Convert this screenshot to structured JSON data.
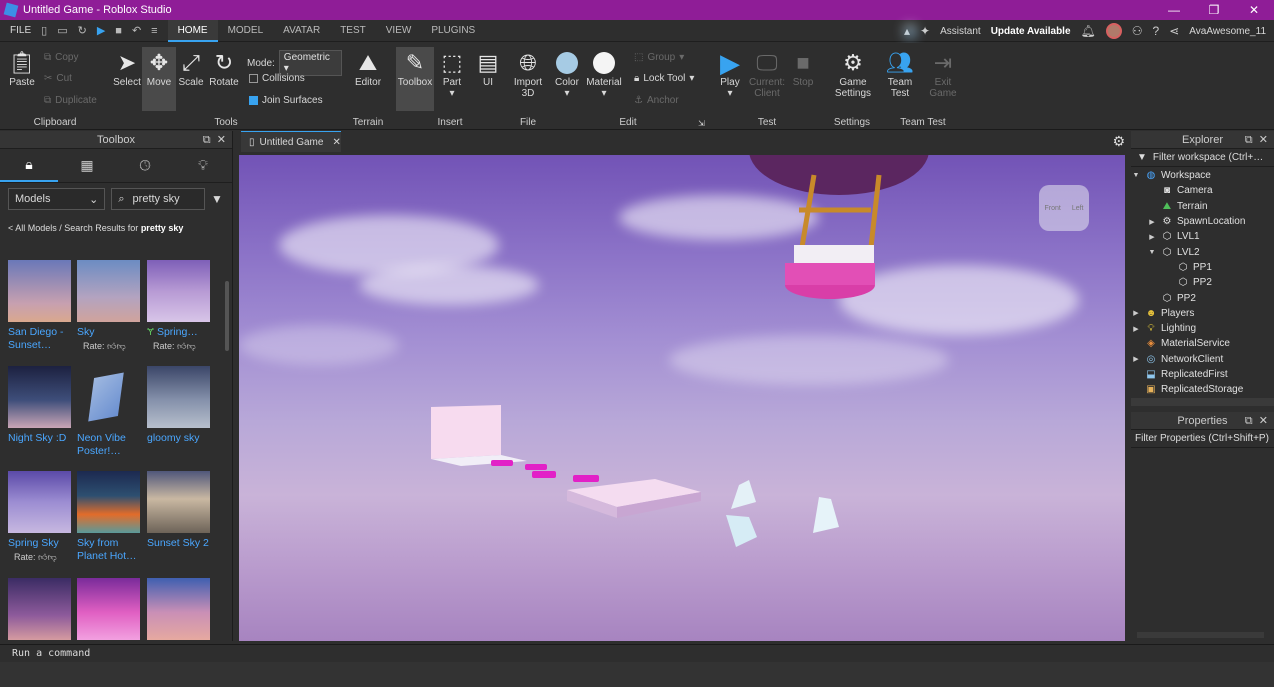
{
  "window": {
    "title": "Untitled Game - Roblox Studio",
    "minimize": "—",
    "maximize": "❐",
    "close": "✕"
  },
  "menu": {
    "file": "FILE",
    "tabs": [
      "HOME",
      "MODEL",
      "AVATAR",
      "TEST",
      "VIEW",
      "PLUGINS"
    ],
    "assistant": "Assistant",
    "update": "Update Available",
    "username": "AvaAwesome_11"
  },
  "ribbon": {
    "clipboard": {
      "label": "Clipboard",
      "paste": "Paste",
      "copy": "Copy",
      "cut": "Cut",
      "duplicate": "Duplicate"
    },
    "tools": {
      "label": "Tools",
      "select": "Select",
      "move": "Move",
      "scale": "Scale",
      "rotate": "Rotate",
      "mode_label": "Mode:",
      "mode_value": "Geometric",
      "collisions": "Collisions",
      "join_surfaces": "Join Surfaces"
    },
    "terrain": {
      "label": "Terrain",
      "editor": "Editor"
    },
    "insert": {
      "label": "Insert",
      "toolbox": "Toolbox",
      "part": "Part",
      "ui": "UI"
    },
    "file": {
      "label": "File",
      "import3d": "Import 3D"
    },
    "edit": {
      "label": "Edit",
      "color": "Color",
      "material": "Material",
      "group": "Group",
      "lock_tool": "Lock Tool",
      "anchor": "Anchor"
    },
    "test": {
      "label": "Test",
      "play": "Play",
      "current_client": "Current: Client",
      "stop": "Stop"
    },
    "settings": {
      "label": "Settings",
      "game_settings": "Game Settings"
    },
    "team_test": {
      "label": "Team Test",
      "team_test": "Team Test",
      "exit_game": "Exit Game"
    }
  },
  "toolbox": {
    "title": "Toolbox",
    "category": "Models",
    "search": "pretty sky",
    "breadcrumb_prefix": "< All Models / Search Results for ",
    "breadcrumb_query": "pretty sky",
    "rate_label": "Rate:",
    "items": [
      {
        "name": "San Diego - Sunset…",
        "rate": false
      },
      {
        "name": "Sky",
        "rate": true
      },
      {
        "name": "Spring…",
        "rate": true
      },
      {
        "name": "Night Sky :D",
        "rate": false
      },
      {
        "name": "Neon Vibe Poster!…",
        "rate": false
      },
      {
        "name": "gloomy sky",
        "rate": false
      },
      {
        "name": "Spring Sky",
        "rate": true
      },
      {
        "name": "Sky from Planet Hot…",
        "rate": false
      },
      {
        "name": "Sunset Sky 2",
        "rate": false
      }
    ]
  },
  "viewport": {
    "tab": "Untitled Game",
    "cube_front": "Front",
    "cube_left": "Left"
  },
  "explorer": {
    "title": "Explorer",
    "filter": "Filter workspace (Ctrl+…",
    "nodes": [
      {
        "name": "Workspace",
        "icon": "globe-icon"
      },
      {
        "name": "Camera",
        "icon": "camera-icon"
      },
      {
        "name": "Terrain",
        "icon": "terrain-icon"
      },
      {
        "name": "SpawnLocation",
        "icon": "spawn-icon"
      },
      {
        "name": "LVL1",
        "icon": "model-icon"
      },
      {
        "name": "LVL2",
        "icon": "model-icon"
      },
      {
        "name": "PP1",
        "icon": "model-icon"
      },
      {
        "name": "PP2",
        "icon": "model-icon"
      },
      {
        "name": "PP2",
        "icon": "model-icon"
      },
      {
        "name": "Players",
        "icon": "players-icon"
      },
      {
        "name": "Lighting",
        "icon": "lightbulb-icon"
      },
      {
        "name": "MaterialService",
        "icon": "material-icon"
      },
      {
        "name": "NetworkClient",
        "icon": "network-icon"
      },
      {
        "name": "ReplicatedFirst",
        "icon": "replicated-icon"
      },
      {
        "name": "ReplicatedStorage",
        "icon": "storage-icon"
      }
    ]
  },
  "properties": {
    "title": "Properties",
    "filter": "Filter Properties (Ctrl+Shift+P)"
  },
  "command": {
    "placeholder": "Run a command"
  },
  "colors": {
    "titlebar": "#8f1d97",
    "accent": "#38a3f0",
    "link": "#4aa7ff"
  }
}
